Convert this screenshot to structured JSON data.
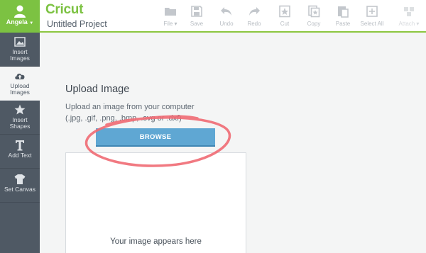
{
  "user": {
    "name": "Angela"
  },
  "brand": {
    "logo": "Cricut",
    "project_title": "Untitled Project"
  },
  "toolbar": [
    {
      "label": "File ▾",
      "icon": "folder-icon"
    },
    {
      "label": "Save",
      "icon": "save-icon"
    },
    {
      "label": "Undo",
      "icon": "undo-icon"
    },
    {
      "label": "Redo",
      "icon": "redo-icon"
    },
    {
      "label": "Cut",
      "icon": "cut-icon"
    },
    {
      "label": "Copy",
      "icon": "copy-icon"
    },
    {
      "label": "Paste",
      "icon": "paste-icon"
    },
    {
      "label": "Select All",
      "icon": "select-all-icon"
    },
    {
      "label": "Attach ▾",
      "icon": "attach-icon"
    }
  ],
  "sidebar": [
    {
      "line1": "Insert",
      "line2": "Images",
      "icon": "image-icon",
      "active": false
    },
    {
      "line1": "Upload",
      "line2": "Images",
      "icon": "cloud-upload-icon",
      "active": true
    },
    {
      "line1": "Insert",
      "line2": "Shapes",
      "icon": "shapes-icon",
      "active": false
    },
    {
      "line1": "Add Text",
      "line2": "",
      "icon": "text-icon",
      "active": false
    },
    {
      "line1": "Set Canvas",
      "line2": "",
      "icon": "tshirt-icon",
      "active": false
    }
  ],
  "upload": {
    "title": "Upload Image",
    "desc_line1": "Upload an image from your computer",
    "desc_line2": "(.jpg, .gif, .png, .bmp, .svg or .dxf)",
    "browse_label": "BROWSE",
    "preview_text": "Your image appears here"
  },
  "colors": {
    "brand_green": "#7cc242",
    "sidebar_bg": "#4f5964",
    "button_blue": "#5fa7d3",
    "annotation_red": "#f06a73"
  }
}
